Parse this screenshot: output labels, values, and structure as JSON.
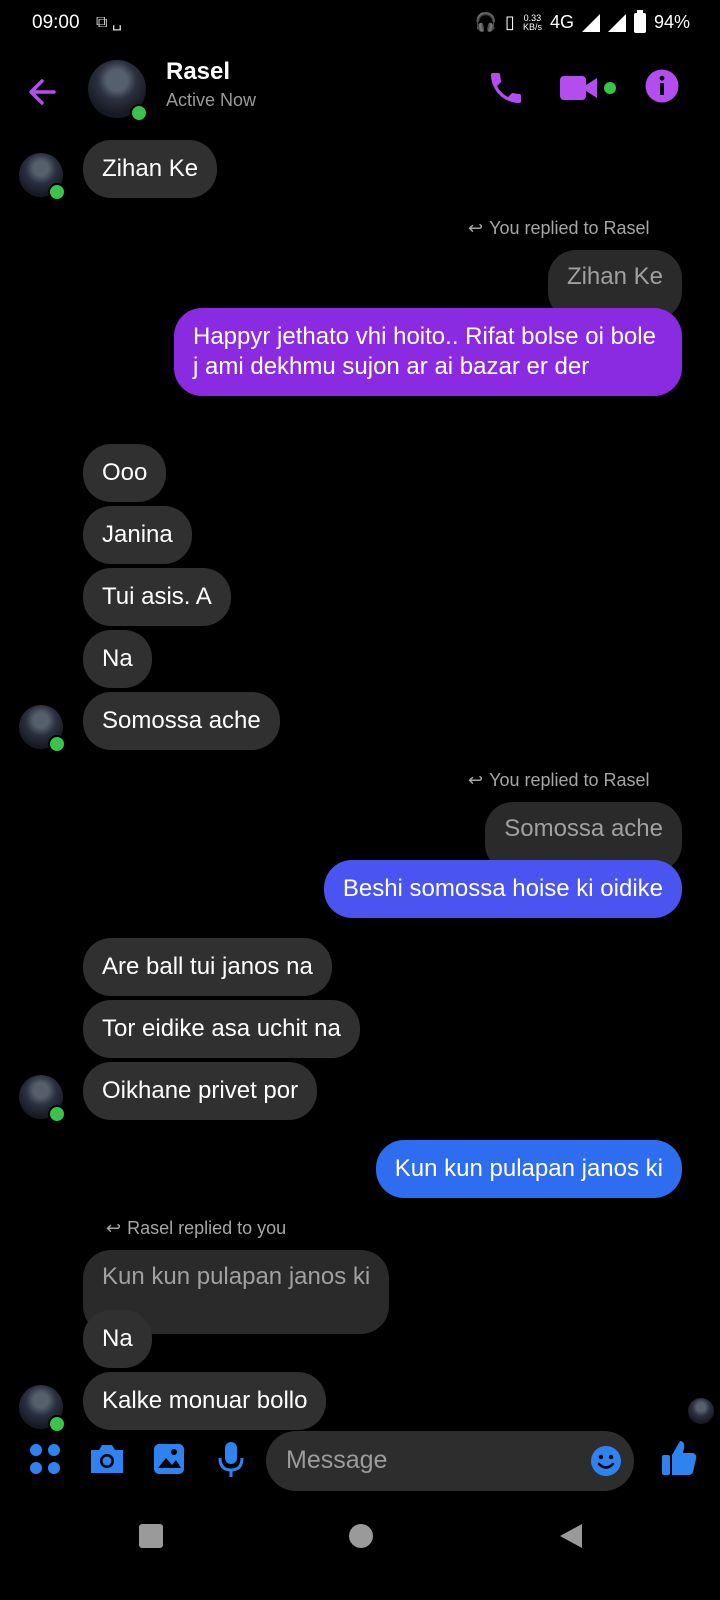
{
  "status_bar": {
    "time": "09:00",
    "network_speed": "0.33\nKB/s",
    "network_type": "4G",
    "battery": "94%"
  },
  "header": {
    "contact_name": "Rasel",
    "presence": "Active Now",
    "icons": [
      "back-arrow-icon",
      "phone-icon",
      "video-icon",
      "info-icon"
    ],
    "accent_color": "#b34df0"
  },
  "messages": [
    {
      "side": "in",
      "text": "Zihan Ke"
    },
    {
      "side": "reply_label_out",
      "text": "You replied to Rasel"
    },
    {
      "side": "quoted",
      "text": "Zihan Ke"
    },
    {
      "side": "out",
      "text": "Happyr jethato vhi hoito.. Rifat bolse oi bole j ami dekhmu sujon ar ai bazar er der"
    },
    {
      "side": "in",
      "text": "Ooo"
    },
    {
      "side": "in",
      "text": "Janina"
    },
    {
      "side": "in",
      "text": "Tui asis. A"
    },
    {
      "side": "in",
      "text": "Na"
    },
    {
      "side": "in",
      "text": "Somossa ache"
    },
    {
      "side": "reply_label_out",
      "text": "You replied to Rasel"
    },
    {
      "side": "quoted",
      "text": "Somossa ache"
    },
    {
      "side": "out",
      "text": "Beshi somossa hoise ki oidike"
    },
    {
      "side": "in",
      "text": "Are ball tui janos na"
    },
    {
      "side": "in",
      "text": "Tor eidike asa uchit na"
    },
    {
      "side": "in",
      "text": "Oikhane privet por"
    },
    {
      "side": "out",
      "text": "Kun kun pulapan janos ki"
    },
    {
      "side": "reply_label_in",
      "text": "Rasel replied to you"
    },
    {
      "side": "quoted",
      "text": "Kun kun pulapan janos ki"
    },
    {
      "side": "in",
      "text": "Na"
    },
    {
      "side": "in",
      "text": "Kalke monuar bollo"
    }
  ],
  "composer": {
    "placeholder": "Message",
    "icons": [
      "apps-icon",
      "camera-icon",
      "gallery-icon",
      "mic-icon",
      "emoji-icon",
      "like-icon"
    ],
    "accent_color": "#2f83f0"
  }
}
